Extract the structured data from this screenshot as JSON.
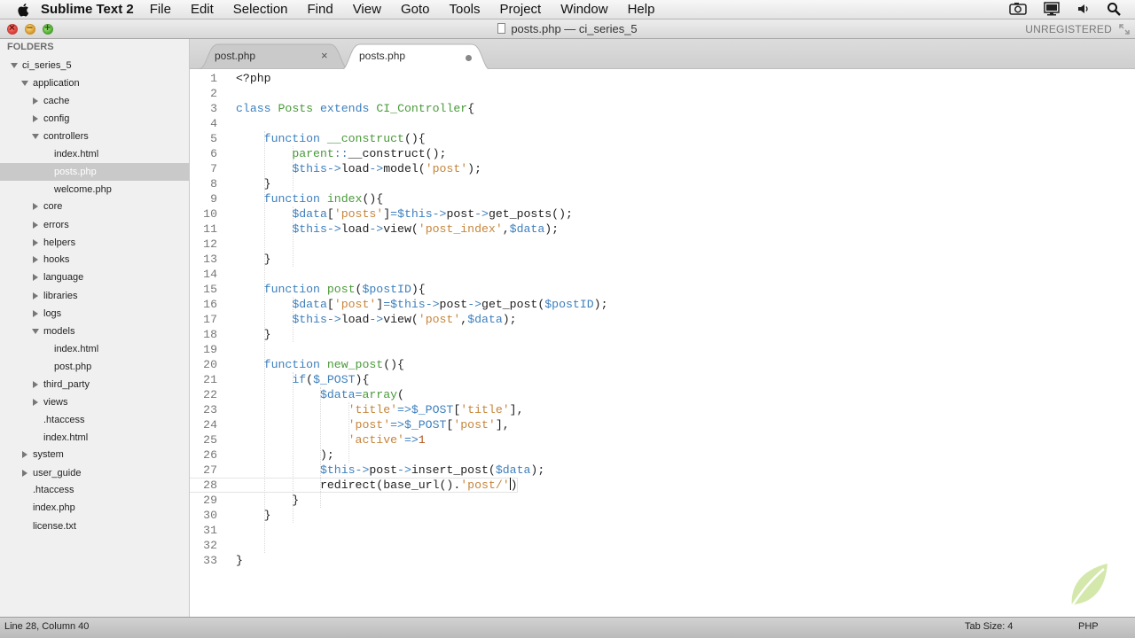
{
  "menubar": {
    "app_name": "Sublime Text 2",
    "items": [
      "File",
      "Edit",
      "Selection",
      "Find",
      "View",
      "Goto",
      "Tools",
      "Project",
      "Window",
      "Help"
    ],
    "icons": [
      "camera-icon",
      "display-icon",
      "volume-icon",
      "search-icon"
    ]
  },
  "window": {
    "title": "posts.php — ci_series_5",
    "license": "UNREGISTERED"
  },
  "sidebar": {
    "header": "FOLDERS",
    "items": [
      {
        "label": "ci_series_5",
        "type": "folder-open"
      },
      {
        "label": "application",
        "type": "folder-open"
      },
      {
        "label": "cache",
        "type": "folder-closed"
      },
      {
        "label": "config",
        "type": "folder-closed"
      },
      {
        "label": "controllers",
        "type": "folder-open"
      },
      {
        "label": "index.html",
        "type": "file"
      },
      {
        "label": "posts.php",
        "type": "file",
        "selected": true
      },
      {
        "label": "welcome.php",
        "type": "file"
      },
      {
        "label": "core",
        "type": "folder-closed"
      },
      {
        "label": "errors",
        "type": "folder-closed"
      },
      {
        "label": "helpers",
        "type": "folder-closed"
      },
      {
        "label": "hooks",
        "type": "folder-closed"
      },
      {
        "label": "language",
        "type": "folder-closed"
      },
      {
        "label": "libraries",
        "type": "folder-closed"
      },
      {
        "label": "logs",
        "type": "folder-closed"
      },
      {
        "label": "models",
        "type": "folder-open"
      },
      {
        "label": "index.html",
        "type": "file"
      },
      {
        "label": "post.php",
        "type": "file"
      },
      {
        "label": "third_party",
        "type": "folder-closed"
      },
      {
        "label": "views",
        "type": "folder-closed"
      },
      {
        "label": ".htaccess",
        "type": "file"
      },
      {
        "label": "index.html",
        "type": "file"
      },
      {
        "label": "system",
        "type": "folder-closed"
      },
      {
        "label": "user_guide",
        "type": "folder-closed"
      },
      {
        "label": ".htaccess",
        "type": "file"
      },
      {
        "label": "index.php",
        "type": "file"
      },
      {
        "label": "license.txt",
        "type": "file"
      }
    ]
  },
  "tabs": [
    {
      "label": "post.php",
      "close": "×",
      "active": false
    },
    {
      "label": "posts.php",
      "active": true,
      "dirty": true
    }
  ],
  "editor": {
    "lines": [
      "<?php",
      "",
      "class Posts extends CI_Controller{",
      "",
      "    function __construct(){",
      "        parent::__construct();",
      "        $this->load->model('post');",
      "    }",
      "    function index(){",
      "        $data['posts']=$this->post->get_posts();",
      "        $this->load->view('post_index',$data);",
      "",
      "    }",
      "",
      "    function post($postID){",
      "        $data['post']=$this->post->get_post($postID);",
      "        $this->load->view('post',$data);",
      "    }",
      "",
      "    function new_post(){",
      "        if($_POST){",
      "            $data=array(",
      "                'title'=>$_POST['title'],",
      "                'post'=>$_POST['post'],",
      "                'active'=>1",
      "            );",
      "            $this->post->insert_post($data);",
      "            redirect(base_url().'post/')",
      "        }",
      "    }",
      "",
      "",
      "}"
    ],
    "current_line": 28
  },
  "statusbar": {
    "position": "Line 28, Column 40",
    "tab_size": "Tab Size: 4",
    "syntax": "PHP"
  },
  "colors": {
    "keyword": "#3d7fbd",
    "function_name": "#4a9a3a",
    "string": "#c7853b",
    "number": "#b5531f",
    "selected_sidebar": "#c9c9c9"
  }
}
